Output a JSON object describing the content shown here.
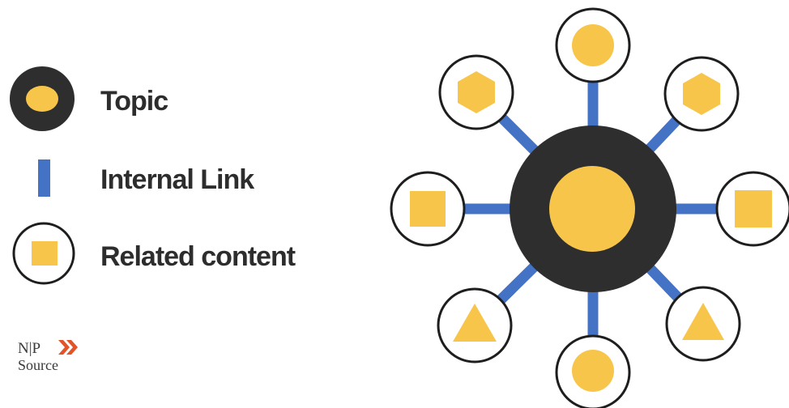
{
  "legend": {
    "topic_label": "Topic",
    "link_label": "Internal Link",
    "related_label": "Related content"
  },
  "logo": {
    "line1": "N|P",
    "line2": "Source"
  },
  "colors": {
    "hub_dark": "#2e2e2e",
    "accent_yellow": "#f8c54b",
    "link_blue": "#4472c4",
    "node_border": "#1e1e1e",
    "logo_arrow": "#e2532a"
  },
  "diagram": {
    "center": {
      "name": "topic-hub",
      "shape": "circle"
    },
    "satellites": [
      {
        "name": "top",
        "shape": "circle"
      },
      {
        "name": "top-right",
        "shape": "hexagon"
      },
      {
        "name": "right",
        "shape": "square"
      },
      {
        "name": "bottom-right",
        "shape": "triangle"
      },
      {
        "name": "bottom",
        "shape": "circle"
      },
      {
        "name": "bottom-left",
        "shape": "triangle"
      },
      {
        "name": "left",
        "shape": "square"
      },
      {
        "name": "top-left",
        "shape": "hexagon"
      }
    ]
  }
}
